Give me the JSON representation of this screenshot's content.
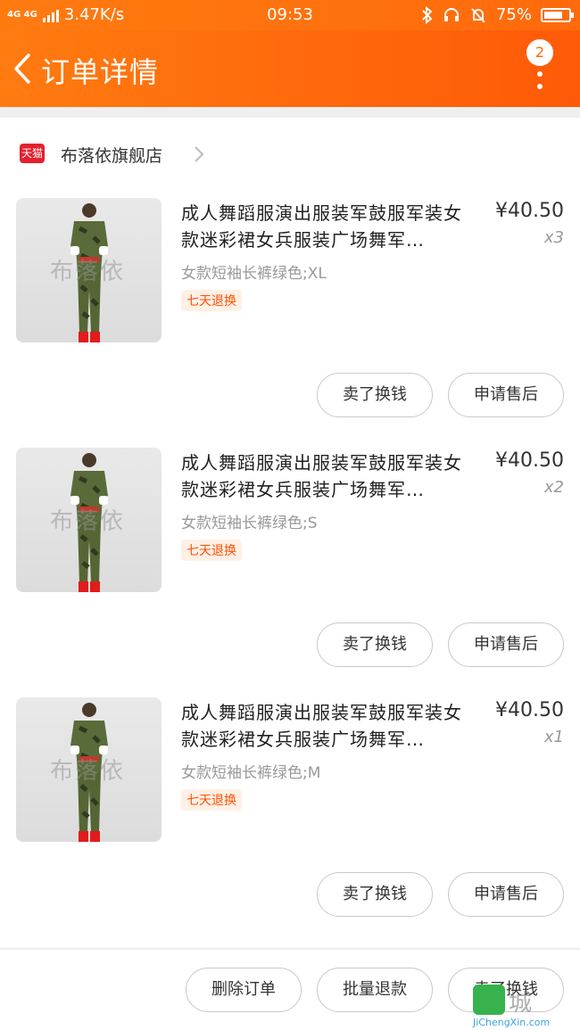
{
  "status_bar": {
    "network": "4G 4G",
    "speed": "3.47K/s",
    "time": "09:53",
    "battery": "75%",
    "battery_level": 0.75,
    "icons": [
      "bluetooth-icon",
      "headset-icon",
      "mute-icon",
      "battery-icon"
    ]
  },
  "nav": {
    "title": "订单详情",
    "badge": "2"
  },
  "store": {
    "platform_badge": "天猫",
    "name": "布落依旗舰店"
  },
  "items": [
    {
      "title": "成人舞蹈服演出服装军鼓服军装女款迷彩裙女兵服装广场舞军…",
      "price": "¥40.50",
      "qty": "x3",
      "spec": "女款短袖长裤绿色;XL",
      "tag": "七天退换",
      "btn1": "卖了换钱",
      "btn2": "申请售后"
    },
    {
      "title": "成人舞蹈服演出服装军鼓服军装女款迷彩裙女兵服装广场舞军…",
      "price": "¥40.50",
      "qty": "x2",
      "spec": "女款短袖长裤绿色;S",
      "tag": "七天退换",
      "btn1": "卖了换钱",
      "btn2": "申请售后"
    },
    {
      "title": "成人舞蹈服演出服装军鼓服军装女款迷彩裙女兵服装广场舞军…",
      "price": "¥40.50",
      "qty": "x1",
      "spec": "女款短袖长裤绿色;M",
      "tag": "七天退换",
      "btn1": "卖了换钱",
      "btn2": "申请售后"
    }
  ],
  "thumb_watermark": "布落依",
  "bottom_bar": {
    "delete": "删除订单",
    "bulk_refund": "批量退款",
    "sell": "卖了换钱"
  },
  "watermark": {
    "cn": "城",
    "en": "JiChengXin.com"
  },
  "colors": {
    "brand": "#ff6a0c",
    "tag_text": "#ff5000",
    "tmall": "#e4202e"
  }
}
